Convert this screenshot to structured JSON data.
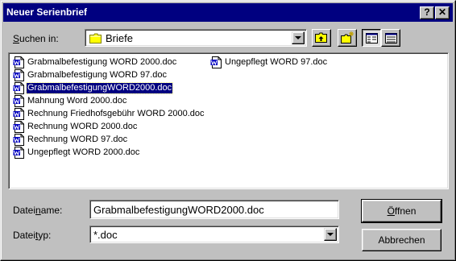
{
  "window": {
    "title": "Neuer Serienbrief",
    "help_glyph": "?",
    "close_glyph": "✕"
  },
  "lookin": {
    "label_prefix": "",
    "label_underlined": "S",
    "label_suffix": "uchen in:",
    "value": "Briefe",
    "icon": "folder-icon"
  },
  "toolbar": {
    "buttons": [
      {
        "name": "up-one-level",
        "icon": "folder-up-icon"
      },
      {
        "name": "create-new-folder",
        "icon": "new-folder-icon"
      },
      {
        "name": "list-view",
        "icon": "list-view-icon",
        "pressed": true
      },
      {
        "name": "details-view",
        "icon": "details-view-icon"
      }
    ]
  },
  "files": [
    {
      "name": "Grabmalbefestigung WORD 2000.doc",
      "icon": "word-document-icon"
    },
    {
      "name": "Grabmalbefestigung WORD 97.doc",
      "icon": "word-document-icon"
    },
    {
      "name": "GrabmalbefestigungWORD2000.doc",
      "icon": "word-document-icon",
      "selected": true
    },
    {
      "name": "Mahnung Word 2000.doc",
      "icon": "word-document-icon"
    },
    {
      "name": "Rechnung Friedhofsgebühr WORD 2000.doc",
      "icon": "word-document-icon"
    },
    {
      "name": "Rechnung WORD 2000.doc",
      "icon": "word-document-icon"
    },
    {
      "name": "Rechnung WORD 97.doc",
      "icon": "word-document-icon"
    },
    {
      "name": "Ungepflegt WORD 2000.doc",
      "icon": "word-document-icon"
    },
    {
      "name": "Ungepflegt WORD 97.doc",
      "icon": "word-document-icon"
    }
  ],
  "filename": {
    "label_prefix": "Datei",
    "label_underlined": "n",
    "label_suffix": "ame:",
    "value": "GrabmalbefestigungWORD2000.doc"
  },
  "filetype": {
    "label_prefix": "Datei",
    "label_underlined": "t",
    "label_suffix": "yp:",
    "value": "*.doc"
  },
  "buttons": {
    "open_underlined": "Ö",
    "open_rest": "ffnen",
    "cancel": "Abbrechen"
  },
  "colors": {
    "titlebar": "#000080",
    "face": "#c0c0c0",
    "selection": "#000080",
    "folder": "#ffff00",
    "word_blue": "#0000c0"
  }
}
